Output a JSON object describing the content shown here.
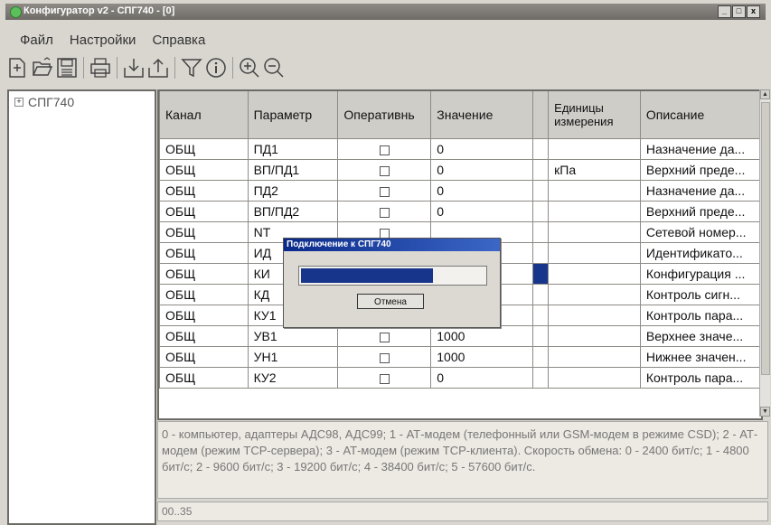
{
  "window": {
    "title": "Конфигуратор v2 - СПГ740 - [0]",
    "min_label": "_",
    "max_label": "□",
    "close_label": "x"
  },
  "menu": [
    "Файл",
    "Настройки",
    "Справка"
  ],
  "toolbar": [
    "new-icon",
    "open-icon",
    "save-icon",
    "print-icon",
    "import-icon",
    "export-icon",
    "filter-icon",
    "info-icon",
    "zoom-in-icon",
    "zoom-out-icon"
  ],
  "tree": {
    "root_expander": "+",
    "root_label": "СПГ740"
  },
  "grid": {
    "columns": [
      "Канал",
      "Параметр",
      "Оперативнь",
      "Значение",
      "",
      "Единицы измерения",
      "Описание"
    ],
    "rows": [
      {
        "channel": "ОБЩ",
        "param": "ПД1",
        "value": "0",
        "unit": "",
        "desc": "Назначение да..."
      },
      {
        "channel": "ОБЩ",
        "param": "ВП/ПД1",
        "value": "0",
        "unit": "кПа",
        "desc": "Верхний преде..."
      },
      {
        "channel": "ОБЩ",
        "param": "ПД2",
        "value": "0",
        "unit": "",
        "desc": "Назначение да..."
      },
      {
        "channel": "ОБЩ",
        "param": "ВП/ПД2",
        "value": "0",
        "unit": "",
        "desc": "Верхний преде..."
      },
      {
        "channel": "ОБЩ",
        "param": "NT",
        "value": "",
        "unit": "",
        "desc": "Сетевой номер..."
      },
      {
        "channel": "ОБЩ",
        "param": "ИД",
        "value": "",
        "unit": "",
        "desc": "Идентификато..."
      },
      {
        "channel": "ОБЩ",
        "param": "КИ",
        "value": "",
        "unit": "",
        "desc": "Конфигурация ..."
      },
      {
        "channel": "ОБЩ",
        "param": "КД",
        "value": "",
        "unit": "",
        "desc": "Контроль сигн..."
      },
      {
        "channel": "ОБЩ",
        "param": "КУ1",
        "value": "0",
        "unit": "",
        "desc": "Контроль пара..."
      },
      {
        "channel": "ОБЩ",
        "param": "УВ1",
        "value": "1000",
        "unit": "",
        "desc": "Верхнее значе..."
      },
      {
        "channel": "ОБЩ",
        "param": "УН1",
        "value": "1000",
        "unit": "",
        "desc": "Нижнее значен..."
      },
      {
        "channel": "ОБЩ",
        "param": "КУ2",
        "value": "0",
        "unit": "",
        "desc": "Контроль пара..."
      }
    ]
  },
  "description": "0 - компьютер, адаптеры АДС98, АДС99; 1 - АТ-модем (телефонный или GSM-модем в режиме CSD); 2 - АТ-модем (режим TCP-сервера); 3 - АТ-модем (режим TCP-клиента). Скорость обмена: 0 - 2400 бит/с; 1 - 4800 бит/с; 2 - 9600 бит/с; 3 - 19200 бит/с; 4 - 38400 бит/с; 5 - 57600 бит/с.",
  "range": "00..35",
  "dialog": {
    "title": "Подключение к СПГ740",
    "progress": 0.72,
    "cancel_label": "Отмена"
  },
  "colors": {
    "selection": "#17358a",
    "titlebar": "#7f7c78"
  }
}
